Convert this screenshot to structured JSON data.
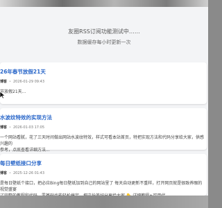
{
  "header": {
    "title": "友圈RSS订阅功能测试中……",
    "subtitle": "数据缓存每小时更新一次"
  },
  "posts": [
    {
      "title": "26年春节放假21天",
      "author": "博客",
      "date": "2026-01-29 09:43",
      "excerpt": "节放假21天..."
    },
    {
      "title": "水波纹特效的实现方法",
      "author": "博客",
      "date": "2026-01-03 17:05",
      "excerpt": "一个网站看腻，花了三天时间做出网站水波纹特效，样式可看本站首页，特把实现方法和代码分享给大家，供感兴趣的\n参考，点底查看详细方法..."
    },
    {
      "title": "每日壁纸接口分享",
      "author": "博客",
      "date": "2025-12-26 01:43",
      "excerpt": "是每日壁纸个接口，把必应Bing每日壁纸加到自己的网站里了 每天自动更新不重样，打开网页就是很致养眼的视觉盛宴\n了完整的教程和代码，零基础也能轻松搞定，把这份美好分享给大家 👇 详细教程+可用代..."
    }
  ]
}
